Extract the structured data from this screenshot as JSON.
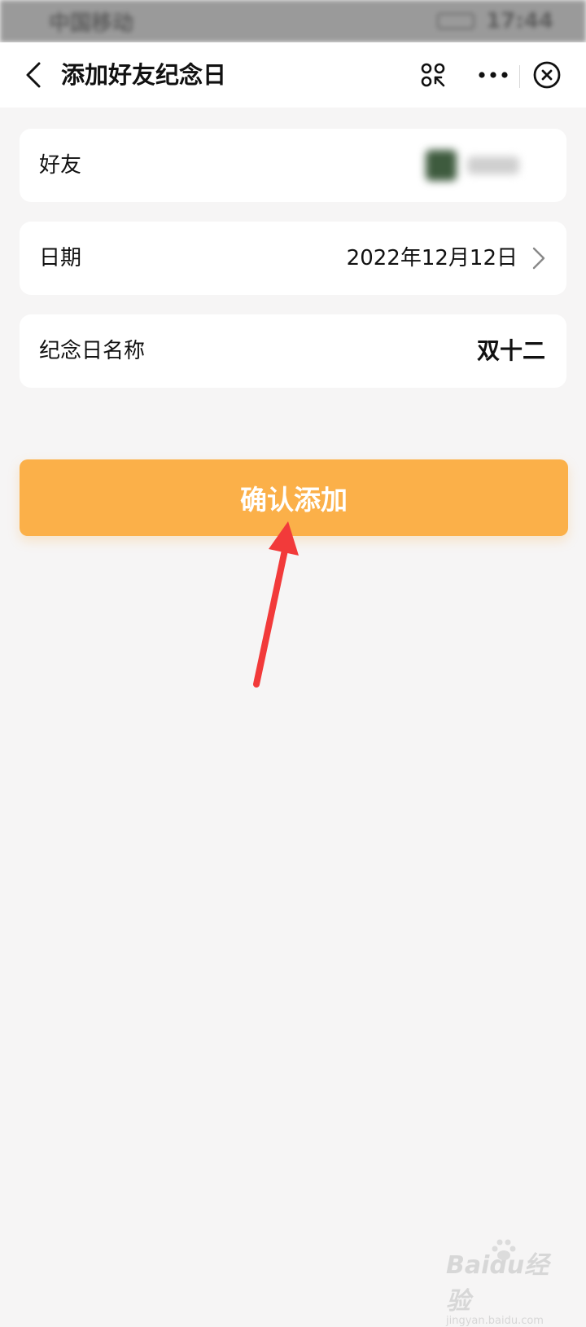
{
  "status_bar": {
    "carrier": "中国移动",
    "time": "17:44"
  },
  "nav": {
    "title": "添加好友纪念日",
    "icons": [
      "back-icon",
      "scan-icon",
      "more-icon",
      "close-icon"
    ]
  },
  "form": {
    "friend_label": "好友",
    "date_label": "日期",
    "date_value": "2022年12月12日",
    "name_label": "纪念日名称",
    "name_value": "双十二"
  },
  "confirm_button_label": "确认添加",
  "watermark": {
    "logo": "Baidu经验",
    "url": "jingyan.baidu.com"
  },
  "colors": {
    "accent": "#fbb049",
    "arrow": "#f23a3a",
    "background": "#f6f5f5"
  }
}
